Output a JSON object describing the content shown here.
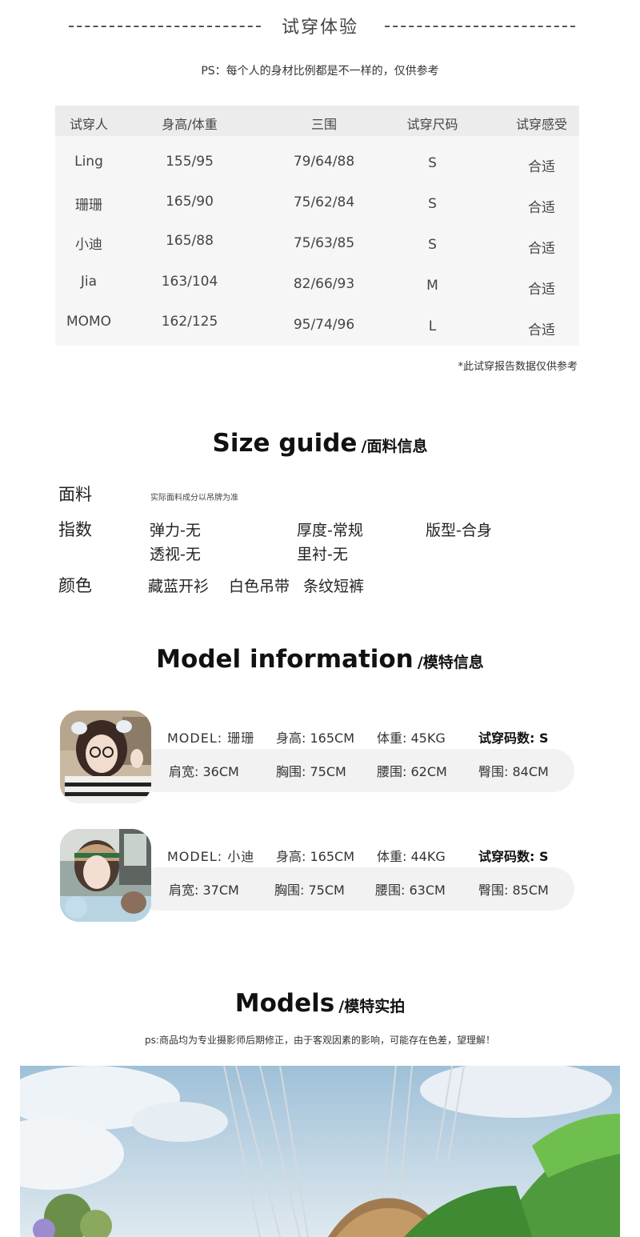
{
  "tryon": {
    "title": "试穿体验",
    "ps": "PS：每个人的身材比例都是不一样的，仅供参考",
    "headers": [
      "试穿人",
      "身高/体重",
      "三围",
      "试穿尺码",
      "试穿感受"
    ],
    "rows": [
      [
        "Ling",
        "155/95",
        "79/64/88",
        "S",
        "合适"
      ],
      [
        "珊珊",
        "165/90",
        "75/62/84",
        "S",
        "合适"
      ],
      [
        "小迪",
        "165/88",
        "75/63/85",
        "S",
        "合适"
      ],
      [
        "Jia",
        "163/104",
        "82/66/93",
        "M",
        "合适"
      ],
      [
        "MOMO",
        "162/125",
        "95/74/96",
        "L",
        "合适"
      ]
    ],
    "note": "*此试穿报告数据仅供参考"
  },
  "size_guide": {
    "title_en": "Size guide",
    "title_cn": "/面料信息",
    "fabric_label": "面料",
    "fabric_note": "实际面料成分以吊牌为准",
    "index_label": "指数",
    "index_values": [
      "弹力-无",
      "厚度-常规",
      "版型-合身",
      "透视-无",
      "里衬-无"
    ],
    "color_label": "颜色",
    "color_values": [
      "藏蓝开衫",
      "白色吊带",
      "条纹短裤"
    ]
  },
  "model_info": {
    "title_en": "Model information",
    "title_cn": "/模特信息",
    "models": [
      {
        "model": "MODEL: 珊珊",
        "height": "身高: 165CM",
        "weight": "体重: 45KG",
        "size": "试穿码数: S",
        "shoulder": "肩宽: 36CM",
        "bust": "胸围: 75CM",
        "waist": "腰围: 62CM",
        "hip": "臀围: 84CM"
      },
      {
        "model": "MODEL: 小迪",
        "height": "身高: 165CM",
        "weight": "体重: 44KG",
        "size": "试穿码数: S",
        "shoulder": "肩宽: 37CM",
        "bust": "胸围: 75CM",
        "waist": "腰围: 63CM",
        "hip": "臀围: 85CM"
      }
    ]
  },
  "models_photo": {
    "title_en": "Models",
    "title_cn": "/模特实拍",
    "ps": "ps:商品均为专业摄影师后期修正，由于客观因素的影响，可能存在色差，望理解！"
  }
}
